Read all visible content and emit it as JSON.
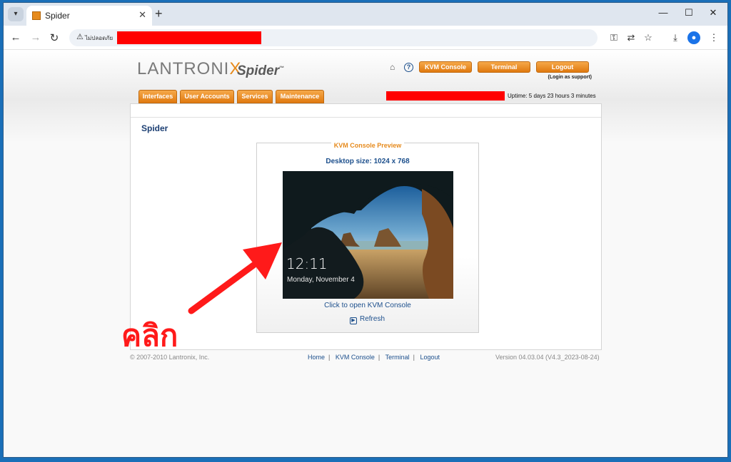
{
  "browser": {
    "tab_title": "Spider",
    "tab_close": "✕",
    "new_tab": "+",
    "security_label": "ไม่ปลอดภัย",
    "controls": {
      "minimize": "—",
      "maximize": "☐",
      "close": "✕"
    }
  },
  "header": {
    "brand": "LANTRONI",
    "brand_x": "X",
    "product": "Spider",
    "tm": "™",
    "buttons": {
      "kvm_console": "KVM Console",
      "terminal": "Terminal",
      "logout": "Logout"
    },
    "login_as": "(Login as support)",
    "uptime": "Uptime: 5 days 23 hours 3 minutes"
  },
  "nav_tabs": [
    {
      "label": "Interfaces"
    },
    {
      "label": "User Accounts"
    },
    {
      "label": "Services"
    },
    {
      "label": "Maintenance"
    }
  ],
  "main": {
    "title": "Spider",
    "kvm_preview": {
      "legend": "KVM Console Preview",
      "desktop_size": "Desktop size: 1024 x 768",
      "clock": "12:11",
      "date": "Monday, November 4",
      "open_link": "Click to open KVM Console",
      "refresh": "Refresh"
    }
  },
  "footer": {
    "copyright": "© 2007-2010 Lantronix, Inc.",
    "links": [
      "Home",
      "KVM Console",
      "Terminal",
      "Logout"
    ],
    "version": "Version 04.03.04 (V4.3_2023-08-24)"
  },
  "annotation": {
    "text": "คลิก",
    "color": "#ff1a1a"
  },
  "colors": {
    "accent_orange": "#e68a1c",
    "link_blue": "#1c4f8c",
    "redaction": "#ff0000"
  }
}
